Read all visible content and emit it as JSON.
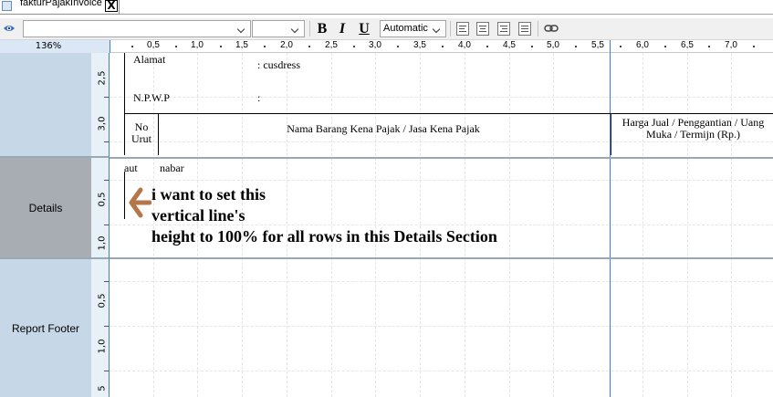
{
  "tab": {
    "title": "fakturPajakInvoice",
    "close_glyph": "X"
  },
  "toolbar": {
    "font_name": "",
    "font_size": "",
    "bold": "B",
    "italic": "I",
    "underline": "U",
    "color": "Automatic",
    "icons": [
      "eye-icon",
      "align-left-icon",
      "align-center-icon",
      "align-right-icon",
      "align-justify-icon",
      "link-icon"
    ]
  },
  "zoom": "136%",
  "hruler": {
    "labels": [
      "0,5",
      "1,0",
      "1,5",
      "2,0",
      "2,5",
      "3,0",
      "3,5",
      "4,0",
      "4,5",
      "5,0",
      "5,5",
      "6,0",
      "6,5",
      "7,0"
    ]
  },
  "sections": [
    {
      "name": "",
      "ruler_labels": [
        "2,5",
        "3,0"
      ]
    },
    {
      "name": "Details",
      "ruler_labels": [
        "0,5",
        "1,0"
      ]
    },
    {
      "name": "Report Footer",
      "ruler_labels": [
        "0,5",
        "1,0",
        "5"
      ]
    }
  ],
  "report": {
    "alamat_label": "Alamat",
    "alamat_value": ":  cusdress",
    "npwp_label": "N.P.W.P",
    "npwp_colon": ":",
    "col_no": "No Urut",
    "col_nama": "Nama Barang Kena Pajak / Jasa Kena Pajak",
    "col_harga": "Harga Jual / Penggantian / Uang Muka / Termijn (Rp.)",
    "detail_field1": "aut",
    "detail_field2": "nabar"
  },
  "annotation": {
    "line1": "i want to set this",
    "line2": "vertical line's",
    "line3": "height to 100%   for all rows in this Details Section",
    "arrow_color": "#b5774a"
  },
  "colors": {
    "accent": "#3e82c4",
    "section_bg": "#c6d8e8",
    "section_selected_bg": "#a8adb3"
  }
}
